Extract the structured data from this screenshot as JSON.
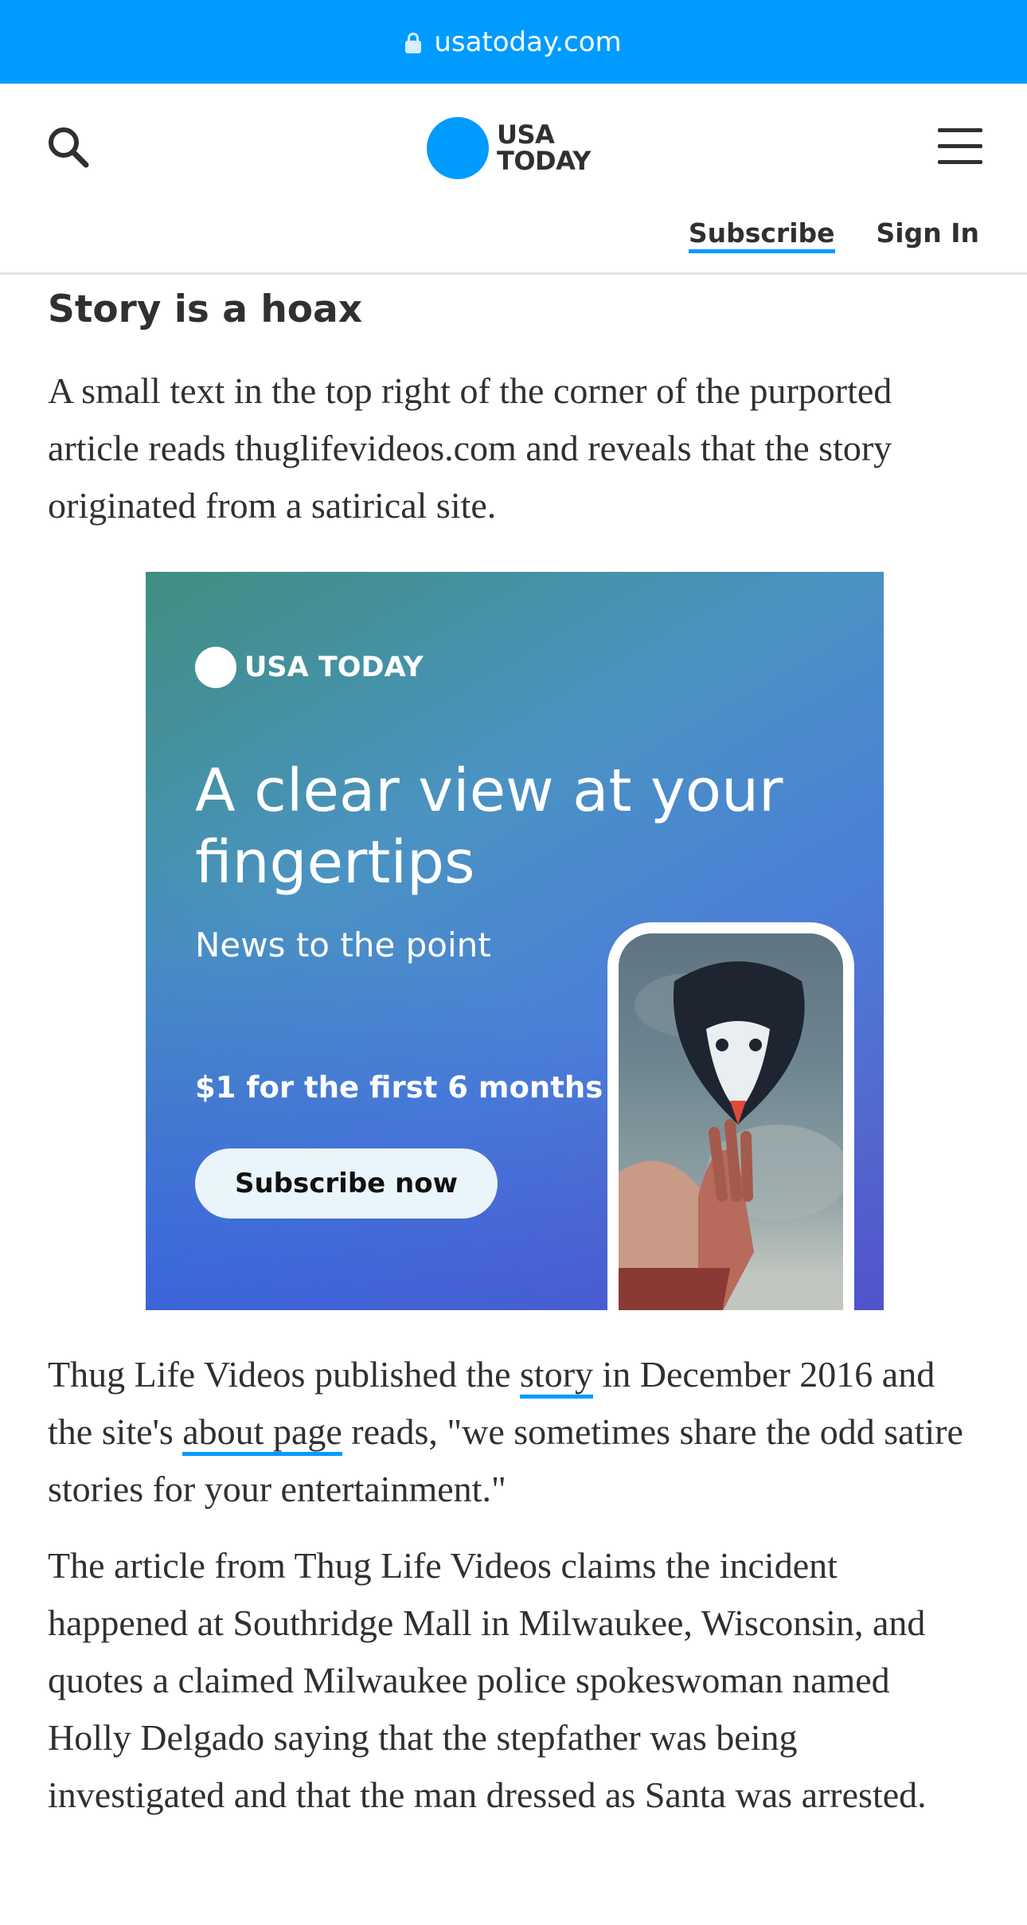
{
  "browser": {
    "url": "usatoday.com"
  },
  "header": {
    "logo_line1": "USA",
    "logo_line2": "TODAY",
    "subscribe_label": "Subscribe",
    "signin_label": "Sign In"
  },
  "article": {
    "heading": "Story is a hoax",
    "p1": "A small text in the top right of the corner of the purported article reads thuglifevideos.com and reveals that the story originated from a satirical site.",
    "p2_before": "Thug Life Videos published the ",
    "p2_link1": "story",
    "p2_middle": " in December 2016 and the site's ",
    "p2_link2": "about page",
    "p2_after": " reads, \"we sometimes share the odd satire stories for your entertainment.\"",
    "p3": "The article from Thug Life Videos claims the incident happened at Southridge Mall in Milwaukee, Wisconsin, and quotes a claimed Milwaukee police spokeswoman named Holly Delgado saying that the stepfather was being investigated and that the man dressed as Santa was arrested."
  },
  "ad": {
    "brand": "USA TODAY",
    "headline": "A clear view at your fingertips",
    "subheadline": "News to the point",
    "price": "$1 for the first 6 months",
    "cta": "Subscribe now"
  },
  "colors": {
    "brand_blue": "#009bff",
    "text": "#303030"
  }
}
